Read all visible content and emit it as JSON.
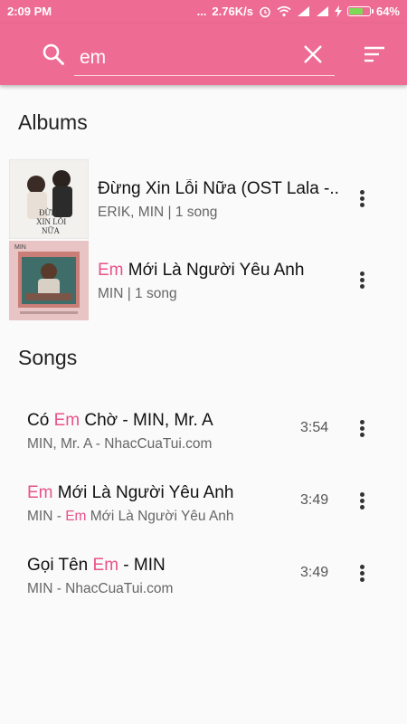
{
  "status_bar": {
    "time": "2:09 PM",
    "dots": "...",
    "net_speed": "2.76K/s",
    "battery": "64%",
    "battery_level": 0.64
  },
  "search": {
    "query": "em",
    "placeholder": ""
  },
  "colors": {
    "accent": "#ee6c94",
    "highlight": "#e8528a"
  },
  "albums": {
    "title": "Albums",
    "items": [
      {
        "title": "Đừng Xin Lỗi Nữa (OST Lala -..",
        "subtitle": "ERIK, MIN | 1 song",
        "cover_text": [
          "ĐỪNG",
          "XIN LỖI",
          "NỮA"
        ]
      },
      {
        "title_hl": "Em",
        "title_rest": " Mới Là Người Yêu Anh",
        "subtitle": "MIN | 1 song",
        "cover_text": [
          "MIN"
        ]
      }
    ]
  },
  "songs": {
    "title": "Songs",
    "items": [
      {
        "t1": "Có ",
        "t2": "Em",
        "t3": " Chờ - MIN, Mr. A",
        "s1": "MIN, Mr. A - NhacCuaTui.com",
        "s2": "",
        "s3": "",
        "duration": "3:54"
      },
      {
        "t1": "",
        "t2": "Em",
        "t3": " Mới Là Người Yêu Anh",
        "s1": "MIN - ",
        "s2": "Em",
        "s3": " Mới Là Người Yêu Anh",
        "duration": "3:49"
      },
      {
        "t1": "Gọi Tên ",
        "t2": "Em",
        "t3": " - MIN",
        "s1": "MIN - NhacCuaTui.com",
        "s2": "",
        "s3": "",
        "duration": "3:49"
      }
    ]
  }
}
